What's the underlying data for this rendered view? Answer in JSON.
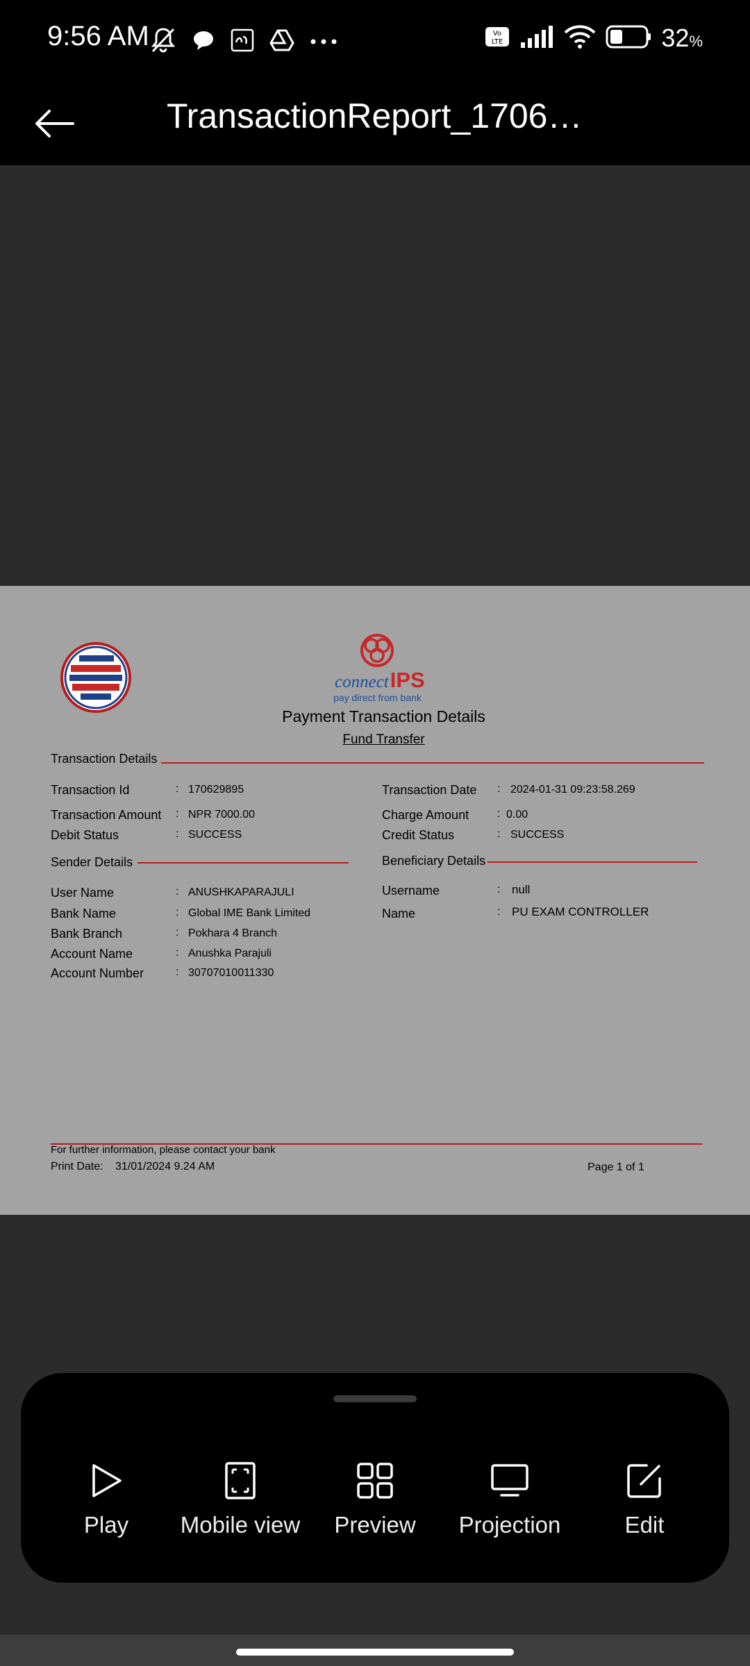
{
  "status_bar": {
    "time": "9:56 AM",
    "battery_percent": "32",
    "battery_unit": "%",
    "icons": [
      "mute-icon",
      "chat-icon",
      "app-icon",
      "drive-icon",
      "more-icon",
      "volte-icon",
      "signal-icon",
      "wifi-icon",
      "battery-icon"
    ]
  },
  "app_bar": {
    "title": "TransactionReport_1706…"
  },
  "document": {
    "heading": "Payment Transaction Details",
    "subheading": "Fund Transfer",
    "ips_logo": {
      "brand_word1": "connect",
      "brand_word2": "IPS",
      "tagline": "pay direct from bank"
    },
    "sections": {
      "transaction": "Transaction Details",
      "sender": "Sender Details",
      "beneficiary": "Beneficiary Details"
    },
    "transaction_left": [
      {
        "label": "Transaction Id",
        "value": "170629895"
      },
      {
        "label": "Transaction Amount",
        "value": "NPR  7000.00"
      },
      {
        "label": "Debit Status",
        "value": "SUCCESS"
      }
    ],
    "transaction_right": [
      {
        "label": "Transaction Date",
        "value": "2024-01-31 09:23:58.269"
      },
      {
        "label": "Charge Amount",
        "value": "0.00"
      },
      {
        "label": "Credit Status",
        "value": "SUCCESS"
      }
    ],
    "sender": [
      {
        "label": "User Name",
        "value": "ANUSHKAPARAJULI"
      },
      {
        "label": "Bank Name",
        "value": "Global IME Bank Limited"
      },
      {
        "label": "Bank Branch",
        "value": "Pokhara 4 Branch"
      },
      {
        "label": "Account Name",
        "value": "Anushka Parajuli"
      },
      {
        "label": "Account Number",
        "value": "30707010011330"
      }
    ],
    "beneficiary": [
      {
        "label": "Username",
        "value": "null"
      },
      {
        "label": "Name",
        "value": "PU EXAM CONTROLLER"
      }
    ],
    "colon": ":",
    "footer": {
      "info": "For further information, please contact your bank",
      "print_date_label": "Print Date:",
      "print_date": "31/01/2024 9.24 AM",
      "page": "Page 1 of 1"
    }
  },
  "bottom_sheet": {
    "actions": [
      {
        "label": "Play",
        "icon": "play-icon"
      },
      {
        "label": "Mobile view",
        "icon": "mobile-view-icon"
      },
      {
        "label": "Preview",
        "icon": "grid-icon"
      },
      {
        "label": "Projection",
        "icon": "monitor-icon"
      },
      {
        "label": "Edit",
        "icon": "edit-icon"
      }
    ]
  },
  "colors": {
    "accent_red": "#b71c1c",
    "ips_red": "#c62828",
    "ips_blue": "#1e4e9c",
    "page_bg": "#a3a3a3",
    "viewer_bg": "#2b2b2b"
  }
}
